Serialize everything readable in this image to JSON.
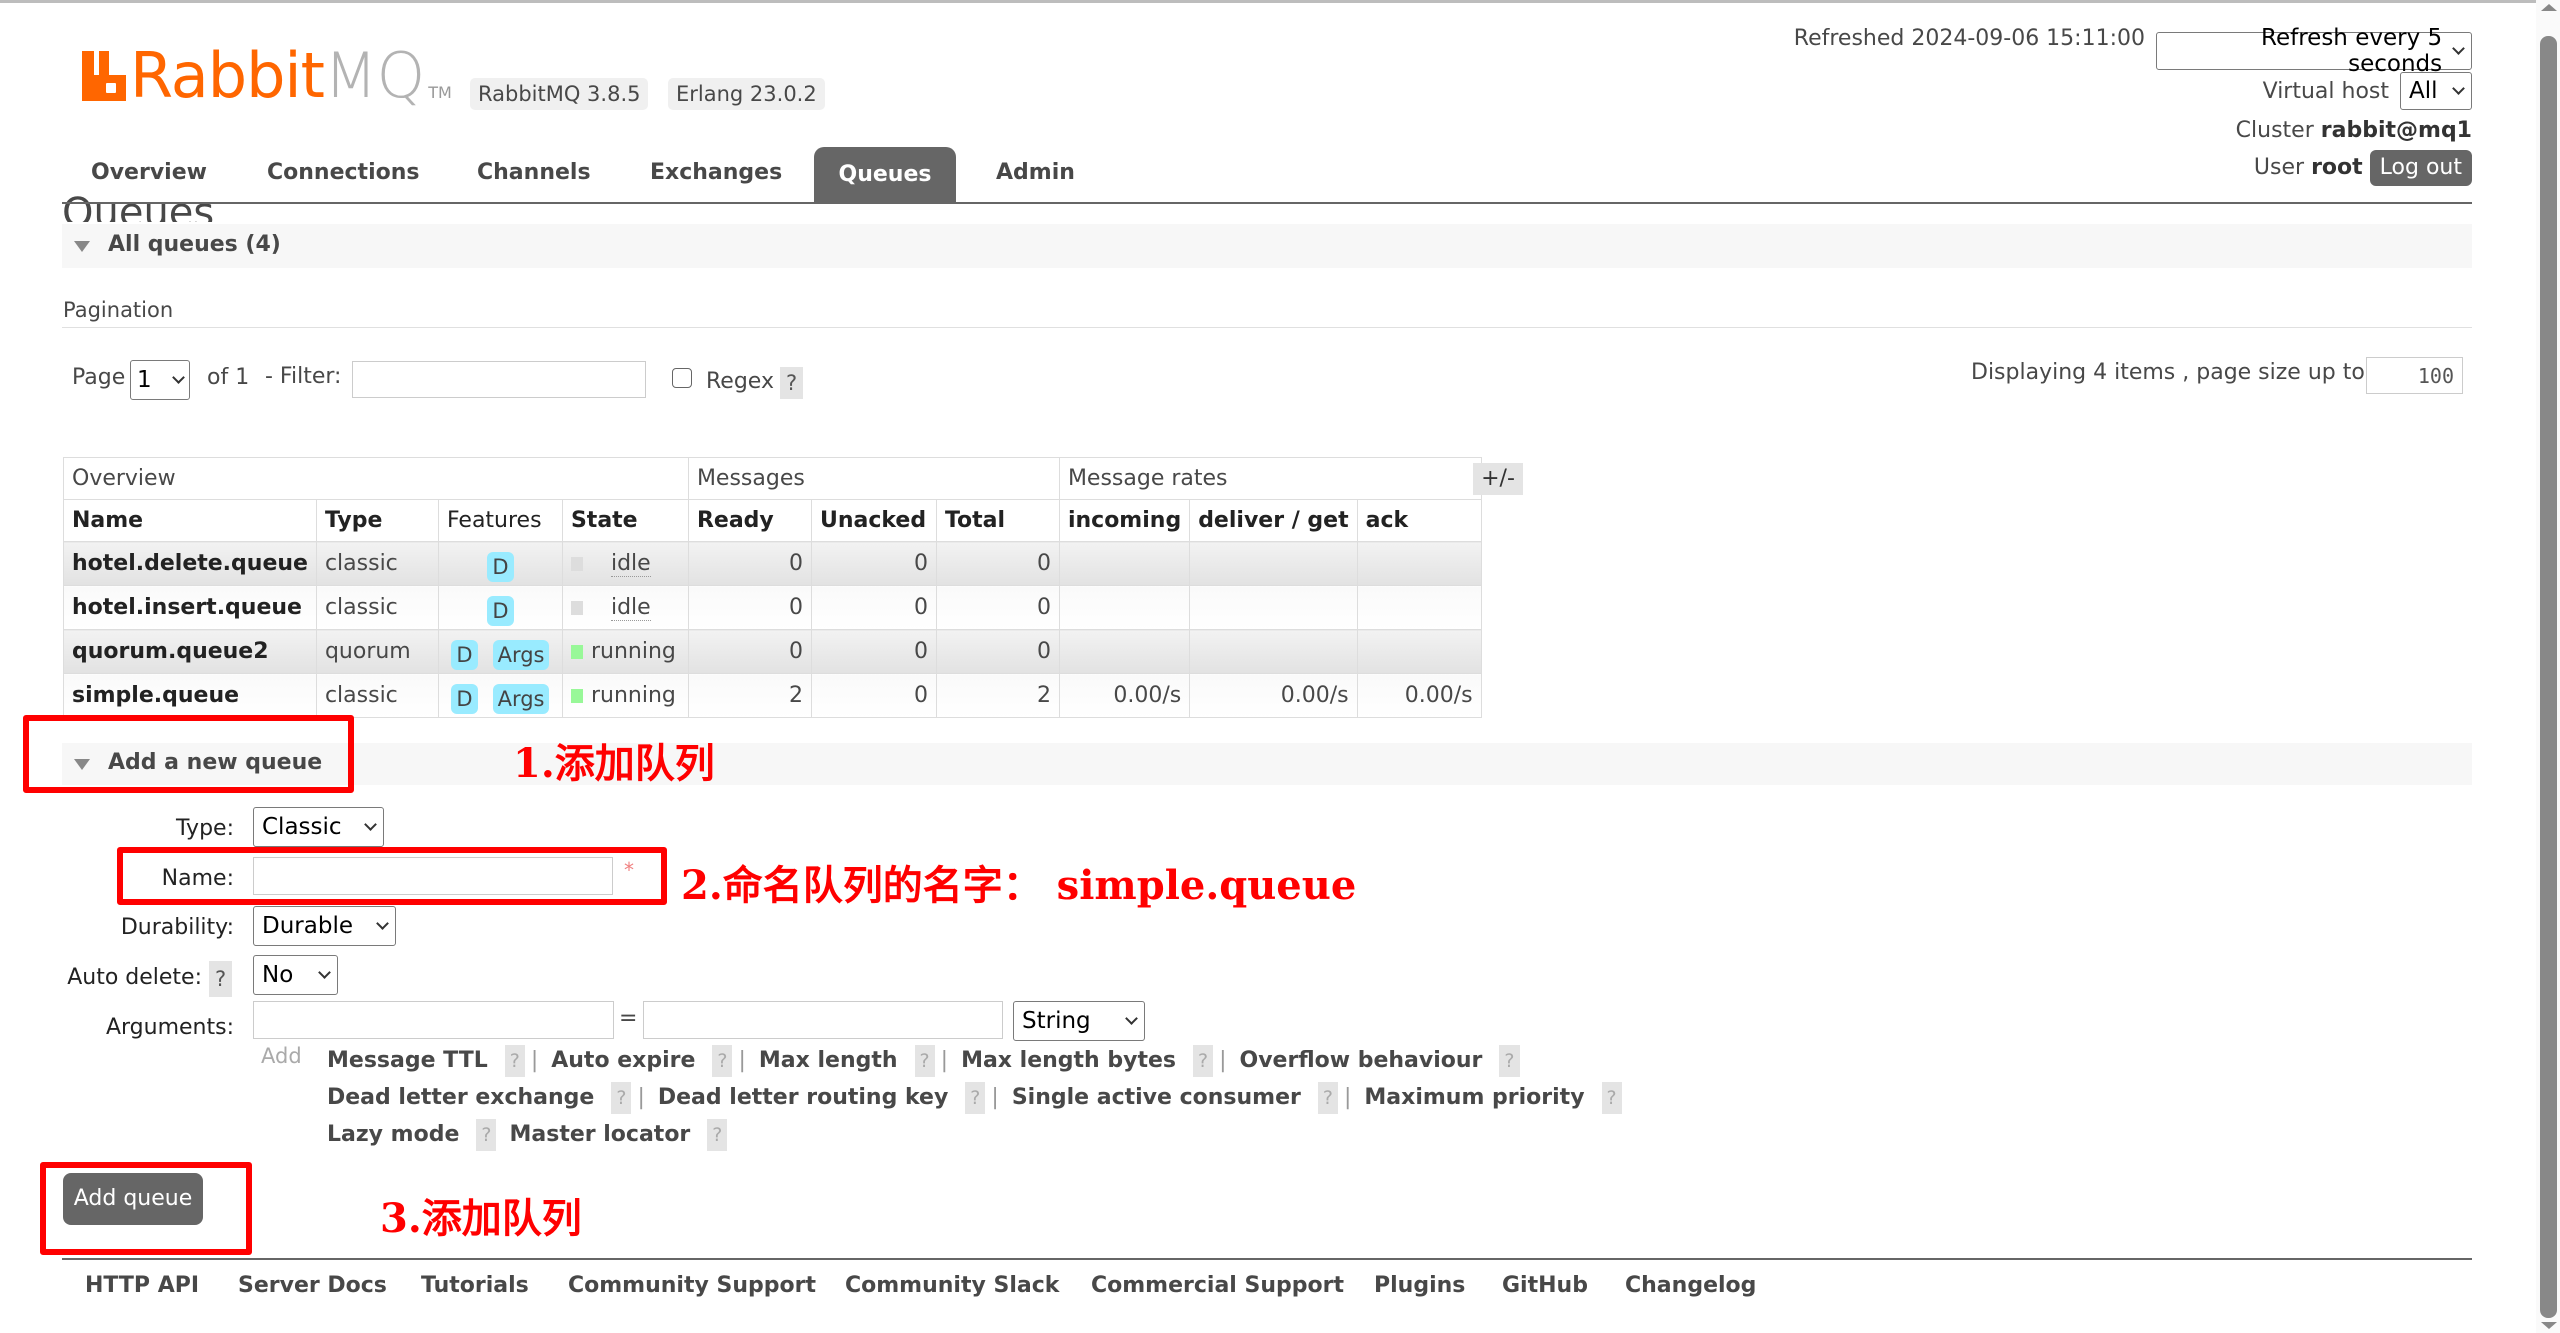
{
  "app": {
    "logo_rabbit": "Rabbit",
    "logo_mq": "MQ",
    "logo_tm": "TM",
    "version_badge": "RabbitMQ 3.8.5",
    "erlang_badge": "Erlang 23.0.2"
  },
  "header": {
    "refreshed_label": "Refreshed 2024-09-06 15:11:00",
    "refresh_select": "Refresh every 5 seconds",
    "vhost_label": "Virtual host",
    "vhost_select": "All",
    "cluster_label": "Cluster",
    "cluster_name": "rabbit@mq1",
    "user_label": "User",
    "user_name": "root",
    "logout": "Log out"
  },
  "nav": {
    "tabs": [
      {
        "label": "Overview"
      },
      {
        "label": "Connections"
      },
      {
        "label": "Channels"
      },
      {
        "label": "Exchanges"
      },
      {
        "label": "Queues",
        "active": true
      },
      {
        "label": "Admin"
      }
    ]
  },
  "page": {
    "title": "Queues",
    "all_queues_label": "All queues (4)"
  },
  "pagination": {
    "label": "Pagination",
    "page_label": "Page",
    "page_value": "1",
    "of_label": "of 1",
    "filter_label": "- Filter:",
    "filter_value": "",
    "regex_label": "Regex",
    "help": "?",
    "displaying": "Displaying 4 items , page size up to:",
    "page_size": "100"
  },
  "table": {
    "groups": [
      "Overview",
      "Messages",
      "Message rates"
    ],
    "columns": [
      "Name",
      "Type",
      "Features",
      "State",
      "Ready",
      "Unacked",
      "Total",
      "incoming",
      "deliver / get",
      "ack"
    ],
    "toggle_columns": "+/-",
    "rows": [
      {
        "name": "hotel.delete.queue",
        "type": "classic",
        "features": [
          "D"
        ],
        "state": "idle",
        "ready": "0",
        "unacked": "0",
        "total": "0",
        "incoming": "",
        "deliver_get": "",
        "ack": ""
      },
      {
        "name": "hotel.insert.queue",
        "type": "classic",
        "features": [
          "D"
        ],
        "state": "idle",
        "ready": "0",
        "unacked": "0",
        "total": "0",
        "incoming": "",
        "deliver_get": "",
        "ack": ""
      },
      {
        "name": "quorum.queue2",
        "type": "quorum",
        "features": [
          "D",
          "Args"
        ],
        "state": "running",
        "ready": "0",
        "unacked": "0",
        "total": "0",
        "incoming": "",
        "deliver_get": "",
        "ack": ""
      },
      {
        "name": "simple.queue",
        "type": "classic",
        "features": [
          "D",
          "Args"
        ],
        "state": "running",
        "ready": "2",
        "unacked": "0",
        "total": "2",
        "incoming": "0.00/s",
        "deliver_get": "0.00/s",
        "ack": "0.00/s"
      }
    ]
  },
  "add_queue": {
    "section_label": "Add a new queue",
    "type_label": "Type:",
    "type_value": "Classic",
    "name_label": "Name:",
    "name_value": "",
    "required_mark": "*",
    "durability_label": "Durability:",
    "durability_value": "Durable",
    "auto_delete_label": "Auto delete:",
    "auto_delete_value": "No",
    "arguments_label": "Arguments:",
    "arg_key": "",
    "arg_equals": "=",
    "arg_value": "",
    "arg_type": "String",
    "add_label": "Add",
    "arg_links_row1": [
      "Message TTL",
      "Auto expire",
      "Max length",
      "Max length bytes",
      "Overflow behaviour"
    ],
    "arg_links_row2": [
      "Dead letter exchange",
      "Dead letter routing key",
      "Single active consumer",
      "Maximum priority"
    ],
    "arg_links_row3": [
      "Lazy mode",
      "Master locator"
    ],
    "help": "?",
    "sep": "|",
    "submit": "Add queue"
  },
  "footer": {
    "links": [
      "HTTP API",
      "Server Docs",
      "Tutorials",
      "Community Support",
      "Community Slack",
      "Commercial Support",
      "Plugins",
      "GitHub",
      "Changelog"
    ]
  },
  "annotations": {
    "step1": "1.添加队列",
    "step2": "2.命名队列的名字：  simple.queue",
    "step3": "3.添加队列"
  }
}
